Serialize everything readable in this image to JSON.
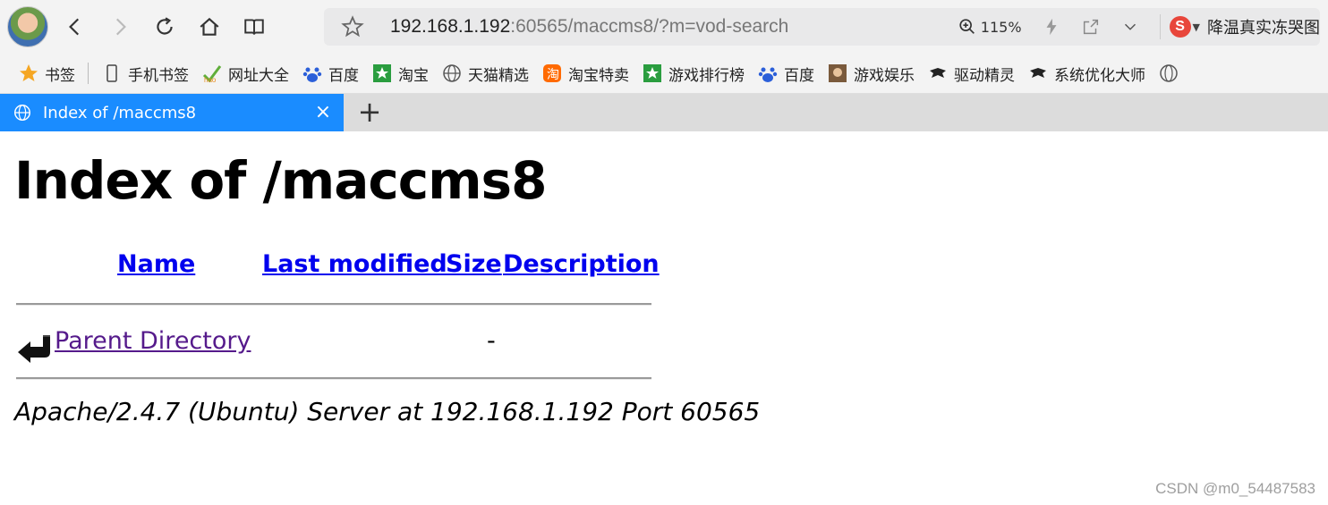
{
  "toolbar": {
    "url_host": "192.168.1.192",
    "url_rest": ":60565/maccms8/?m=vod-search",
    "zoom_level": "115%",
    "search_engine_label": "降温真实冻哭图"
  },
  "bookmarks": [
    {
      "label": "书签",
      "icon": "star-icon"
    },
    {
      "label": "手机书签",
      "icon": "phone-icon"
    },
    {
      "label": "网址大全",
      "icon": "hao-icon"
    },
    {
      "label": "百度",
      "icon": "baidu-icon"
    },
    {
      "label": "淘宝",
      "icon": "taobao-icon"
    },
    {
      "label": "天猫精选",
      "icon": "globe-icon"
    },
    {
      "label": "淘宝特卖",
      "icon": "tao-sale-icon"
    },
    {
      "label": "游戏排行榜",
      "icon": "game-icon"
    },
    {
      "label": "百度",
      "icon": "baidu-icon"
    },
    {
      "label": "游戏娱乐",
      "icon": "game-avatar-icon"
    },
    {
      "label": "驱动精灵",
      "icon": "driver-icon"
    },
    {
      "label": "系统优化大师",
      "icon": "optimizer-icon"
    }
  ],
  "tab": {
    "title": "Index of /maccms8",
    "close_glyph": "×",
    "new_tab_glyph": "+"
  },
  "page": {
    "heading": "Index of /maccms8",
    "columns": [
      "Name",
      "Last modified",
      "Size",
      "Description"
    ],
    "rows": [
      {
        "name": "Parent Directory",
        "last_modified": "",
        "size": "-",
        "description": ""
      }
    ],
    "address": "Apache/2.4.7 (Ubuntu) Server at 192.168.1.192 Port 60565"
  },
  "watermark": "CSDN @m0_54487583",
  "colors": {
    "tab_active": "#1a8cff",
    "link": "#0000ee",
    "visited_link": "#551a8b"
  }
}
